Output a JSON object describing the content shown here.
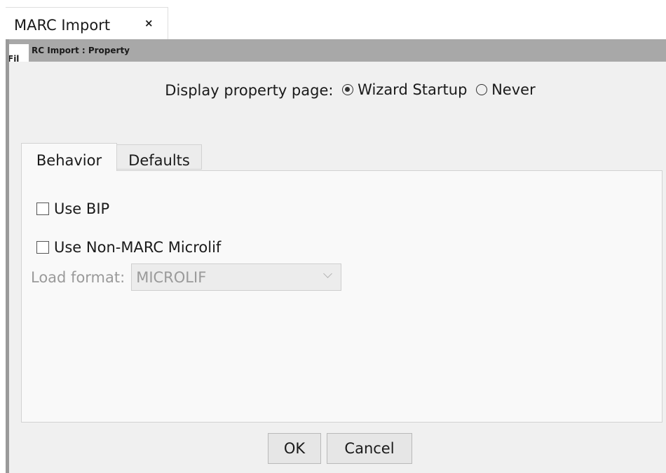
{
  "doc_tab": {
    "label": "MARC Import",
    "close": "×"
  },
  "dialog": {
    "title_overlap": "Fil",
    "title": "RC Import : Property",
    "display_label": "Display property page:",
    "display_options": [
      {
        "label": "Wizard Startup",
        "selected": true
      },
      {
        "label": "Never",
        "selected": false
      }
    ],
    "tabs": [
      {
        "label": "Behavior",
        "active": true
      },
      {
        "label": "Defaults",
        "active": false
      }
    ],
    "behavior": {
      "use_bip": {
        "label": "Use BIP",
        "checked": false
      },
      "use_non_marc": {
        "label": "Use Non-MARC Microlif",
        "checked": false
      },
      "load_format_label": "Load format:",
      "load_format_value": "MICROLIF"
    },
    "buttons": {
      "ok": "OK",
      "cancel": "Cancel"
    }
  }
}
